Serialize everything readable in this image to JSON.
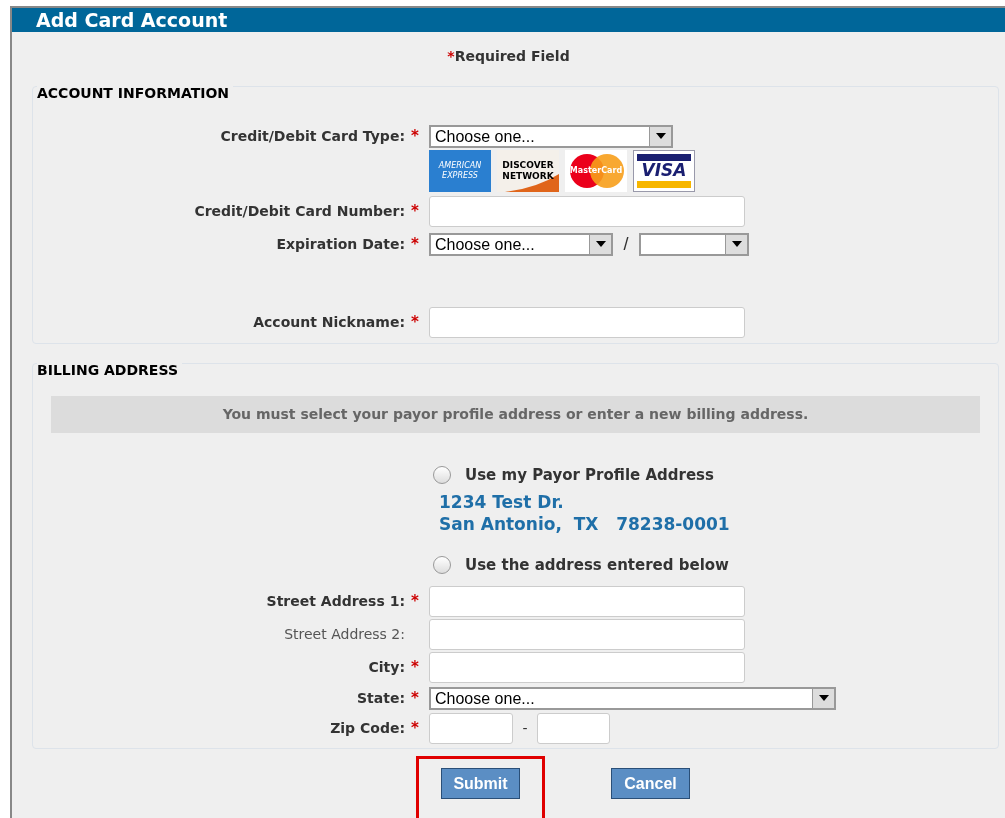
{
  "panel": {
    "title": "Add Card Account"
  },
  "required_note": {
    "mark": "*",
    "text": "Required Field"
  },
  "account_information": {
    "legend": "ACCOUNT INFORMATION",
    "fields": [
      {
        "kind": "select",
        "label": "Credit/Debit Card Type:",
        "required": true,
        "value": "Choose one..."
      },
      {
        "kind": "logos",
        "logos": [
          {
            "kind": "amex",
            "lines": [
              "AMERICAN",
              "EXPRESS"
            ]
          },
          {
            "kind": "discover",
            "lines": [
              "DISCOVER",
              "NETWORK"
            ]
          },
          {
            "kind": "mastercard",
            "lines": [
              "MasterCard"
            ]
          },
          {
            "kind": "visa",
            "lines": [
              "VISA"
            ]
          }
        ]
      },
      {
        "kind": "text",
        "label": "Credit/Debit Card Number:",
        "required": true
      },
      {
        "kind": "date",
        "label": "Expiration Date:",
        "required": true,
        "month": "Choose one...",
        "separator": "/"
      },
      {
        "kind": "spacer"
      },
      {
        "kind": "text",
        "label": "Account Nickname:",
        "required": true
      }
    ]
  },
  "billing_address": {
    "legend": "BILLING ADDRESS",
    "notice": "You must select your payor profile address or enter a new billing address.",
    "options": [
      {
        "label": "Use my Payor Profile Address",
        "selected": false,
        "address_lines": [
          "1234 Test Dr.",
          "San Antonio,  TX   78238-0001"
        ]
      },
      {
        "label": "Use the address entered below",
        "selected": false
      }
    ],
    "fields": [
      {
        "kind": "text",
        "label": "Street Address 1:",
        "required": true
      },
      {
        "kind": "text",
        "label": "Street Address 2:",
        "required": false
      },
      {
        "kind": "text",
        "label": "City:",
        "required": true
      },
      {
        "kind": "select",
        "label": "State:",
        "required": true,
        "value": "Choose one..."
      },
      {
        "kind": "zip",
        "label": "Zip Code:",
        "required": true,
        "separator": "-"
      }
    ]
  },
  "buttons": [
    {
      "label": "Submit",
      "highlighted": true
    },
    {
      "label": "Cancel",
      "highlighted": false
    }
  ]
}
